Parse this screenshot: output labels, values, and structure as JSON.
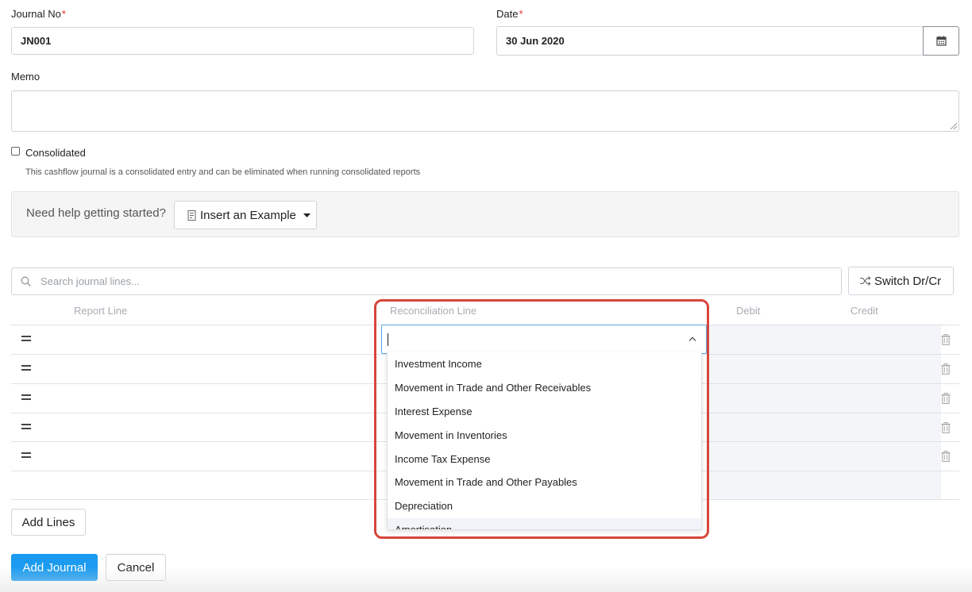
{
  "journal": {
    "label": "Journal No",
    "required_mark": "*",
    "value": "JN001"
  },
  "date": {
    "label": "Date",
    "required_mark": "*",
    "value": "30 Jun 2020",
    "icon": "calendar-icon"
  },
  "memo": {
    "label": "Memo",
    "value": ""
  },
  "consolidated": {
    "label": "Consolidated",
    "checked": false,
    "hint": "This cashflow journal is a consolidated entry and can be eliminated when running consolidated reports"
  },
  "help": {
    "text": "Need help getting started?",
    "button_label": "Insert an Example",
    "button_icon": "document-icon"
  },
  "search": {
    "placeholder": "Search journal lines...",
    "icon": "search-icon"
  },
  "switch": {
    "label": "Switch Dr/Cr",
    "icon": "shuffle-icon"
  },
  "table": {
    "columns": {
      "report_line": "Report Line",
      "reconciliation_line": "Reconciliation Line",
      "debit": "Debit",
      "credit": "Credit"
    },
    "row_count": 5
  },
  "dropdown": {
    "value": "",
    "options": [
      "Investment Income",
      "Movement in Trade and Other Receivables",
      "Interest Expense",
      "Movement in Inventories",
      "Income Tax Expense",
      "Movement in Trade and Other Payables",
      "Depreciation",
      "Amortisation"
    ]
  },
  "actions": {
    "add_lines": "Add Lines",
    "add_journal": "Add Journal",
    "cancel": "Cancel"
  },
  "colors": {
    "primary": "#1a9bf0",
    "highlight": "#d9453b",
    "required": "#e03131"
  }
}
